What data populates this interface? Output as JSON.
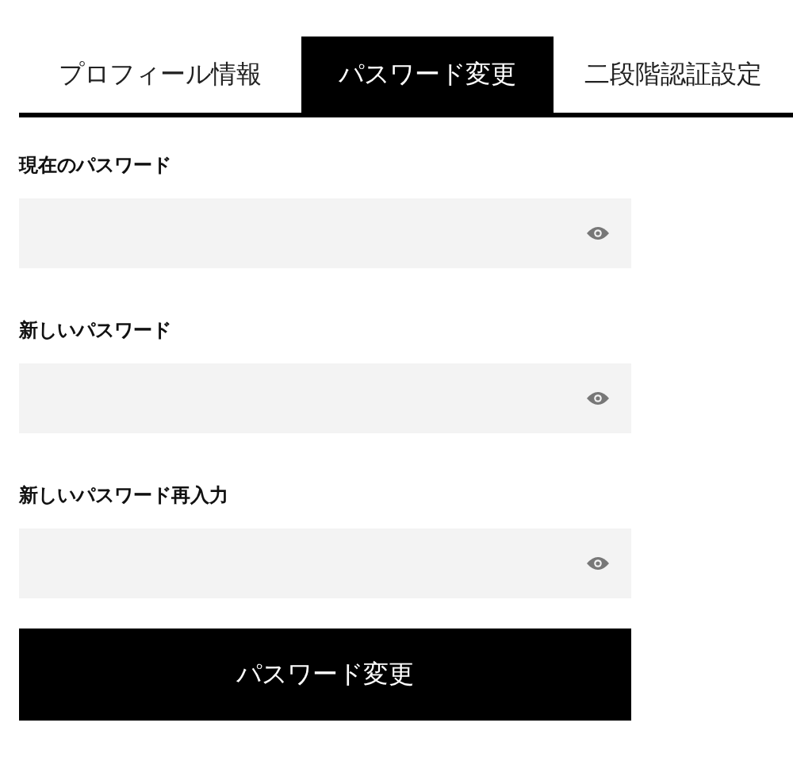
{
  "tabs": [
    {
      "label": "プロフィール情報",
      "selected": false
    },
    {
      "label": "パスワード変更",
      "selected": true
    },
    {
      "label": "二段階認証設定",
      "selected": false
    }
  ],
  "fields": [
    {
      "label": "現在のパスワード"
    },
    {
      "label": "新しいパスワード"
    },
    {
      "label": "新しいパスワード再入力"
    }
  ],
  "submit_button": "パスワード変更"
}
